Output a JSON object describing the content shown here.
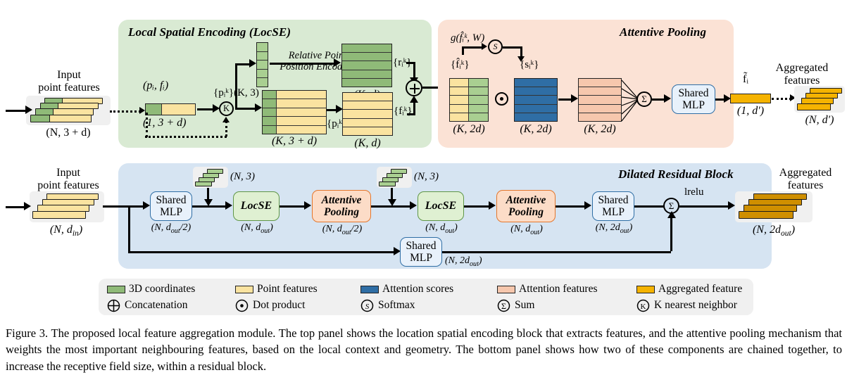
{
  "figure": {
    "panels": {
      "locse": {
        "title": "Local Spatial Encoding (LocSE)",
        "color": "#d9ead3"
      },
      "attentive": {
        "title": "Attentive Pooling",
        "color": "#fbe2d5"
      },
      "dilated": {
        "title": "Dilated Residual Block",
        "color": "#d6e4f2"
      }
    },
    "top": {
      "input_label_line1": "Input",
      "input_label_line2": "point features",
      "input_dims": "(N, 3 + d)",
      "single_point_label": "(pᵢ, fᵢ)",
      "single_point_dims": "(1, 3 + d)",
      "knn_symbol": "K",
      "knn_points_label": "{pᵢᵏ}(K, 3)",
      "knn_group_label": "{pᵢᵏ, fᵢᵏ}",
      "knn_group_dims": "(K, 3 + d)",
      "rppe_line1": "Relative Point",
      "rppe_line2": "Position Encoding",
      "r_label": "{rᵢᵏ}",
      "r_dims": "(K, d)",
      "f_label": "{fᵢᵏ}",
      "f_dims": "(K, d)",
      "concat_symbol": "⊕"
    },
    "attentive": {
      "g_function": "g(f̂ᵢᵏ, W)",
      "softmax_symbol": "S",
      "fhat_label": "{f̂ᵢᵏ}",
      "fhat_dims": "(K, 2d)",
      "dot_symbol": "⊙",
      "scores_label": "{sᵢᵏ}",
      "scores_dims": "(K, 2d)",
      "attn_features_dims": "(K, 2d)",
      "sum_symbol": "Σ",
      "mlp_line1": "Shared",
      "mlp_line2": "MLP",
      "ftilde_label": "f̃ᵢ",
      "ftilde_dims": "(1, d′)",
      "output_line1": "Aggregated",
      "output_line2": "features",
      "output_dims": "(N, d′)"
    },
    "bottom": {
      "input_line1": "Input",
      "input_line2": "point features",
      "input_dims": "(N, d_in)",
      "coords_dims_1": "(N, 3)",
      "coords_dims_2": "(N, 3)",
      "blocks": [
        {
          "name": "shared-mlp-1",
          "line1": "Shared",
          "line2": "MLP",
          "dims": "(N, d_out/2)",
          "kind": "blue"
        },
        {
          "name": "locse-1",
          "line1": "LocSE",
          "line2": "",
          "dims": "(N, d_out)",
          "kind": "green"
        },
        {
          "name": "attentive-pooling-1",
          "line1": "Attentive",
          "line2": "Pooling",
          "dims": "(N, d_out/2)",
          "kind": "orange"
        },
        {
          "name": "locse-2",
          "line1": "LocSE",
          "line2": "",
          "dims": "(N, d_out)",
          "kind": "green"
        },
        {
          "name": "attentive-pooling-2",
          "line1": "Attentive",
          "line2": "Pooling",
          "dims": "(N, d_out)",
          "kind": "orange"
        },
        {
          "name": "shared-mlp-2",
          "line1": "Shared",
          "line2": "MLP",
          "dims": "(N, 2d_out)",
          "kind": "blue"
        }
      ],
      "skip_mlp": {
        "line1": "Shared",
        "line2": "MLP",
        "dims": "(N, 2d_out)"
      },
      "sum_symbol": "Σ",
      "activation": "lrelu",
      "output_line1": "Aggregated",
      "output_line2": "features",
      "output_dims": "(N, 2d_out)"
    },
    "legend": {
      "row1": [
        {
          "label": "3D coordinates",
          "color": "#8fba78",
          "type": "swatch"
        },
        {
          "label": "Point features",
          "color": "#fae3a0",
          "type": "swatch"
        },
        {
          "label": "Attention scores",
          "color": "#2f6ea5",
          "type": "swatch"
        },
        {
          "label": "Attention features",
          "color": "#f6c7ad",
          "type": "swatch"
        },
        {
          "label": "Aggregated feature",
          "color": "#f5b301",
          "type": "swatch"
        }
      ],
      "row2": [
        {
          "label": "Concatenation",
          "symbol": "⊕",
          "type": "symbol"
        },
        {
          "label": "Dot product",
          "symbol": "⊙",
          "type": "symbol"
        },
        {
          "label": "Softmax",
          "symbol": "S",
          "type": "symbol"
        },
        {
          "label": "Sum",
          "symbol": "Σ",
          "type": "symbol"
        },
        {
          "label": "K nearest neighbor",
          "symbol": "K",
          "type": "symbol"
        }
      ]
    },
    "caption": "Figure 3. The proposed local feature aggregation module. The top panel shows the location spatial encoding block that extracts features, and the attentive pooling mechanism that weights the most important neighbouring features, based on the local context and geometry. The bottom panel shows how two of these components are chained together, to increase the receptive field size, within a residual block."
  }
}
